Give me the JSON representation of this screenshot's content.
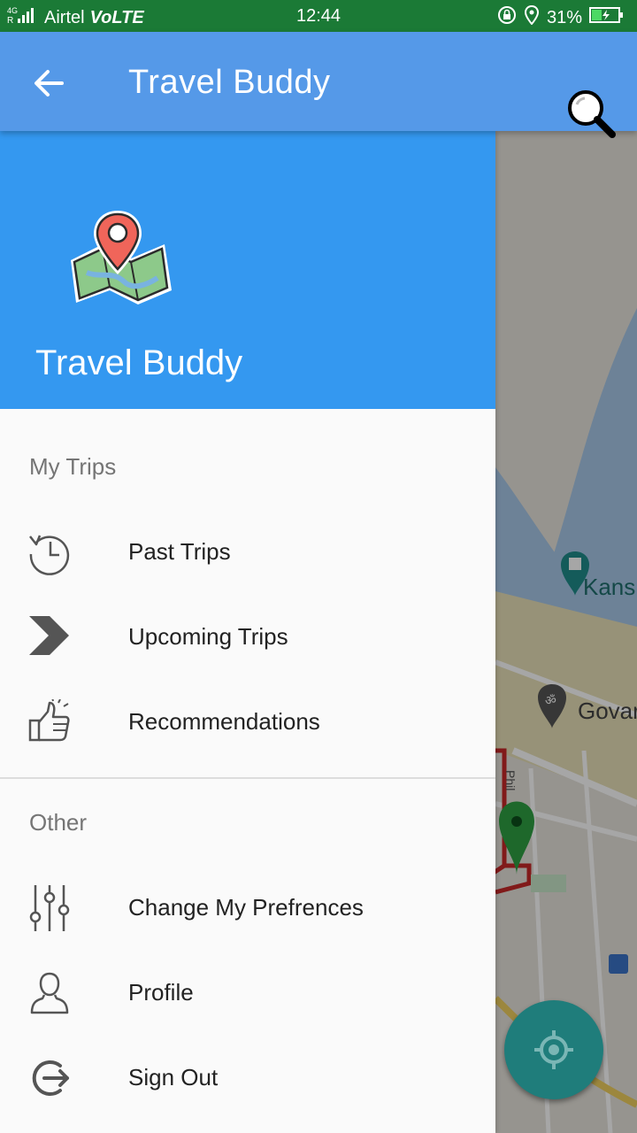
{
  "status_bar": {
    "network": "4G",
    "carrier": "Airtel",
    "volte": "VoLTE",
    "time": "12:44",
    "battery": "31%"
  },
  "app_bar": {
    "title": "Travel Buddy",
    "back_icon": "arrow-back-icon",
    "search_icon": "search-icon"
  },
  "drawer": {
    "header": {
      "logo_icon": "map-pin-logo-icon",
      "app_name": "Travel Buddy",
      "color": "#3498f0"
    },
    "sections": [
      {
        "title": "My Trips",
        "items": [
          {
            "label": "Past Trips",
            "icon": "history-icon"
          },
          {
            "label": "Upcoming Trips",
            "icon": "chevron-right-icon"
          },
          {
            "label": "Recommendations",
            "icon": "thumbs-up-icon"
          }
        ]
      },
      {
        "title": "Other",
        "items": [
          {
            "label": "Change My Prefrences",
            "icon": "sliders-icon"
          },
          {
            "label": "Profile",
            "icon": "person-icon"
          },
          {
            "label": "Sign Out",
            "icon": "sign-out-icon"
          }
        ]
      }
    ]
  },
  "map": {
    "place_labels": [
      "Kans",
      "Govar"
    ],
    "road_label": "Phil",
    "my_location_icon": "gps-icon"
  },
  "colors": {
    "status_bar": "#1b7a36",
    "app_bar": "#5599e8",
    "fab": "#1f7d7b"
  }
}
